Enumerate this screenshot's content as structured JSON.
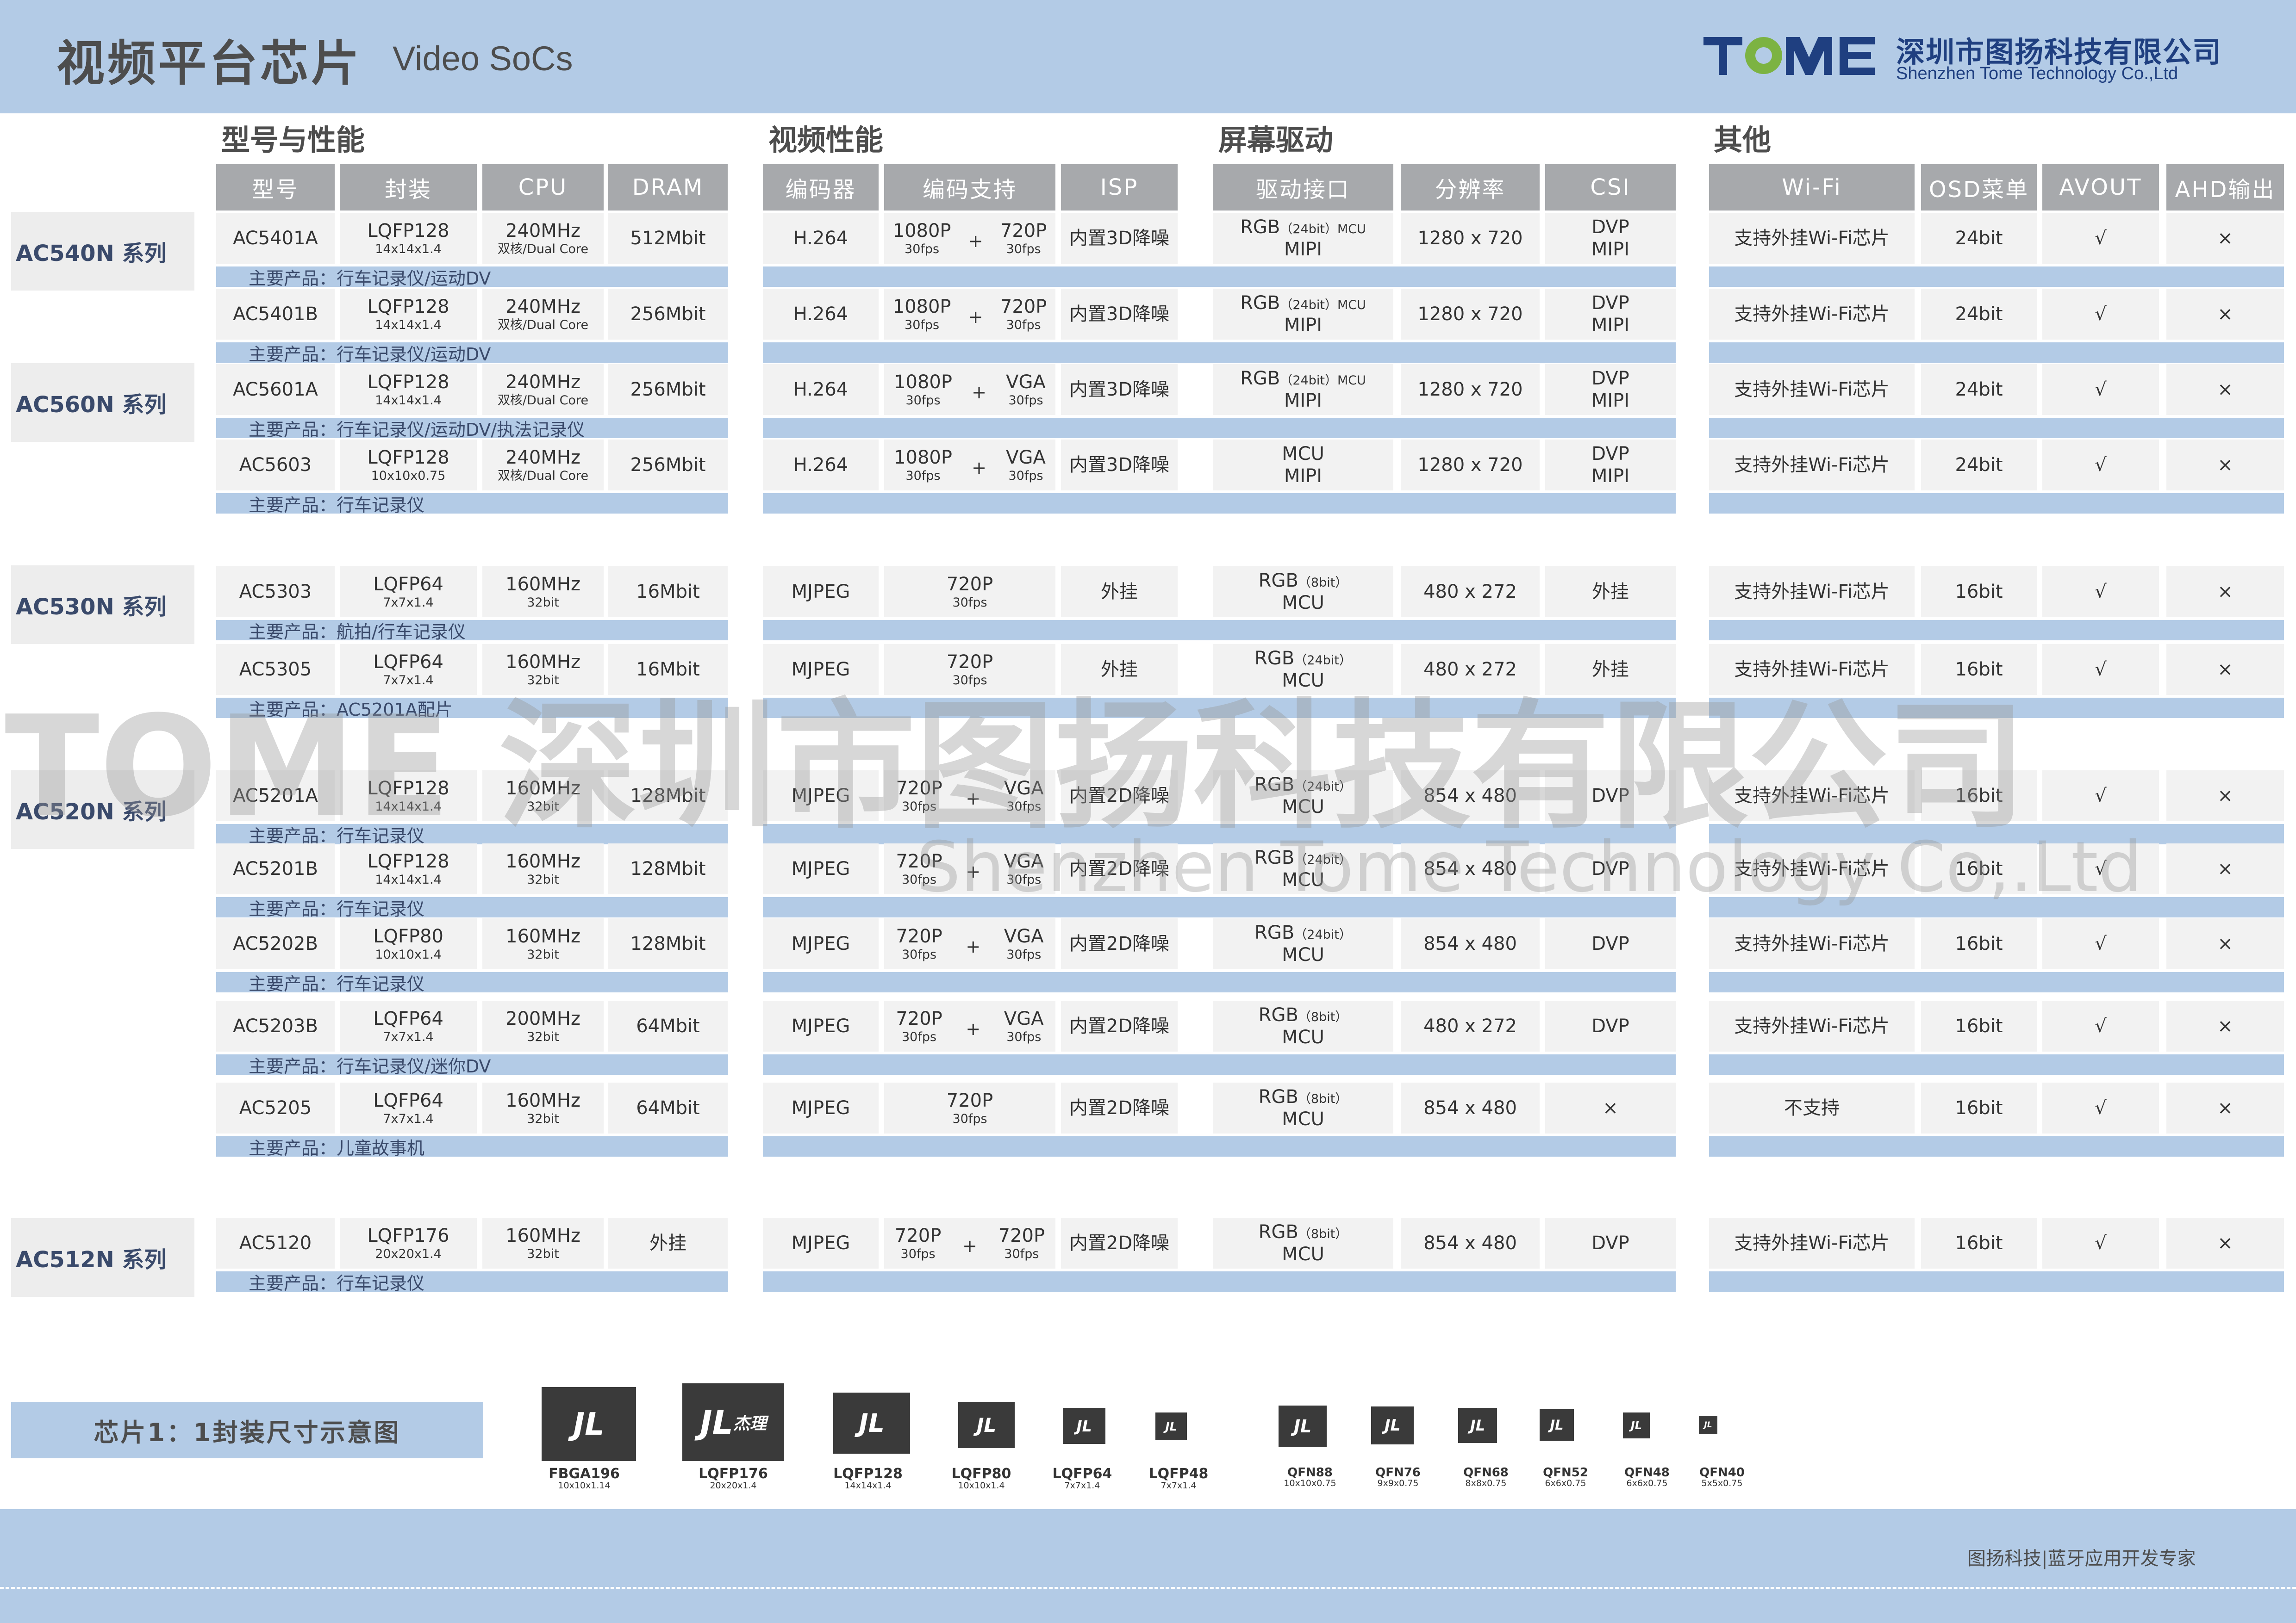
{
  "header": {
    "title_cn": "视频平台芯片",
    "title_en": "Video SoCs",
    "company_cn": "深圳市图扬科技有限公司",
    "company_en": "Shenzhen Tome Technology Co.,Ltd",
    "logo_text": "TOME"
  },
  "sections": {
    "model": "型号与性能",
    "video": "视频性能",
    "screen": "屏幕驱动",
    "other": "其他"
  },
  "columns": [
    "型号",
    "封装",
    "CPU",
    "DRAM",
    "编码器",
    "编码支持",
    "ISP",
    "驱动接口",
    "分辨率",
    "CSI",
    "Wi-Fi",
    "OSD菜单",
    "AVOUT",
    "AHD输出"
  ],
  "series": [
    {
      "label": "AC540N 系列"
    },
    {
      "label": "AC560N 系列"
    },
    {
      "label": "AC530N 系列"
    },
    {
      "label": "AC520N 系列"
    },
    {
      "label": "AC512N 系列"
    }
  ],
  "product_prefix": "主要产品：",
  "rows": [
    {
      "model": "AC5401A",
      "pkg": "LQFP128",
      "pkg_dim": "14x14x1.4",
      "cpu": "240MHz",
      "cpu_sub": "双核/Dual Core",
      "dram": "512Mbit",
      "codec": "H.264",
      "enc": [
        {
          "r": "1080P",
          "f": "30fps"
        },
        {
          "r": "720P",
          "f": "30fps"
        }
      ],
      "isp": "内置3D降噪",
      "drv1": "RGB",
      "drv1s": "（24bit）MCU",
      "drv2": "MIPI",
      "res": "1280 x 720",
      "csi1": "DVP",
      "csi2": "MIPI",
      "wifi": "支持外挂Wi-Fi芯片",
      "osd": "24bit",
      "avout": "√",
      "ahd": "×",
      "product": "行车记录仪/运动DV"
    },
    {
      "model": "AC5401B",
      "pkg": "LQFP128",
      "pkg_dim": "14x14x1.4",
      "cpu": "240MHz",
      "cpu_sub": "双核/Dual Core",
      "dram": "256Mbit",
      "codec": "H.264",
      "enc": [
        {
          "r": "1080P",
          "f": "30fps"
        },
        {
          "r": "720P",
          "f": "30fps"
        }
      ],
      "isp": "内置3D降噪",
      "drv1": "RGB",
      "drv1s": "（24bit）MCU",
      "drv2": "MIPI",
      "res": "1280 x 720",
      "csi1": "DVP",
      "csi2": "MIPI",
      "wifi": "支持外挂Wi-Fi芯片",
      "osd": "24bit",
      "avout": "√",
      "ahd": "×",
      "product": "行车记录仪/运动DV"
    },
    {
      "model": "AC5601A",
      "pkg": "LQFP128",
      "pkg_dim": "14x14x1.4",
      "cpu": "240MHz",
      "cpu_sub": "双核/Dual Core",
      "dram": "256Mbit",
      "codec": "H.264",
      "enc": [
        {
          "r": "1080P",
          "f": "30fps"
        },
        {
          "r": "VGA",
          "f": "30fps"
        }
      ],
      "isp": "内置3D降噪",
      "drv1": "RGB",
      "drv1s": "（24bit）MCU",
      "drv2": "MIPI",
      "res": "1280 x 720",
      "csi1": "DVP",
      "csi2": "MIPI",
      "wifi": "支持外挂Wi-Fi芯片",
      "osd": "24bit",
      "avout": "√",
      "ahd": "×",
      "product": "行车记录仪/运动DV/执法记录仪"
    },
    {
      "model": "AC5603",
      "pkg": "LQFP128",
      "pkg_dim": "10x10x0.75",
      "cpu": "240MHz",
      "cpu_sub": "双核/Dual Core",
      "dram": "256Mbit",
      "codec": "H.264",
      "enc": [
        {
          "r": "1080P",
          "f": "30fps"
        },
        {
          "r": "VGA",
          "f": "30fps"
        }
      ],
      "isp": "内置3D降噪",
      "drv1": "MCU",
      "drv1s": "",
      "drv2": "MIPI",
      "res": "1280 x 720",
      "csi1": "DVP",
      "csi2": "MIPI",
      "wifi": "支持外挂Wi-Fi芯片",
      "osd": "24bit",
      "avout": "√",
      "ahd": "×",
      "product": "行车记录仪"
    },
    {
      "model": "AC5303",
      "pkg": "LQFP64",
      "pkg_dim": "7x7x1.4",
      "cpu": "160MHz",
      "cpu_sub": "32bit",
      "dram": "16Mbit",
      "codec": "MJPEG",
      "enc": [
        {
          "r": "720P",
          "f": "30fps"
        }
      ],
      "isp": "外挂",
      "drv1": "RGB",
      "drv1s": "（8bit）",
      "drv2": "MCU",
      "res": "480 x 272",
      "csi1": "外挂",
      "csi2": "",
      "wifi": "支持外挂Wi-Fi芯片",
      "osd": "16bit",
      "avout": "√",
      "ahd": "×",
      "product": "航拍/行车记录仪"
    },
    {
      "model": "AC5305",
      "pkg": "LQFP64",
      "pkg_dim": "7x7x1.4",
      "cpu": "160MHz",
      "cpu_sub": "32bit",
      "dram": "16Mbit",
      "codec": "MJPEG",
      "enc": [
        {
          "r": "720P",
          "f": "30fps"
        }
      ],
      "isp": "外挂",
      "drv1": "RGB",
      "drv1s": "（24bit）",
      "drv2": "MCU",
      "res": "480 x 272",
      "csi1": "外挂",
      "csi2": "",
      "wifi": "支持外挂Wi-Fi芯片",
      "osd": "16bit",
      "avout": "√",
      "ahd": "×",
      "product": "AC5201A配片"
    },
    {
      "model": "AC5201A",
      "pkg": "LQFP128",
      "pkg_dim": "14x14x1.4",
      "cpu": "160MHz",
      "cpu_sub": "32bit",
      "dram": "128Mbit",
      "codec": "MJPEG",
      "enc": [
        {
          "r": "720P",
          "f": "30fps"
        },
        {
          "r": "VGA",
          "f": "30fps"
        }
      ],
      "isp": "内置2D降噪",
      "drv1": "RGB",
      "drv1s": "（24bit）",
      "drv2": "MCU",
      "res": "854 x 480",
      "csi1": "DVP",
      "csi2": "",
      "wifi": "支持外挂Wi-Fi芯片",
      "osd": "16bit",
      "avout": "√",
      "ahd": "×",
      "product": "行车记录仪"
    },
    {
      "model": "AC5201B",
      "pkg": "LQFP128",
      "pkg_dim": "14x14x1.4",
      "cpu": "160MHz",
      "cpu_sub": "32bit",
      "dram": "128Mbit",
      "codec": "MJPEG",
      "enc": [
        {
          "r": "720P",
          "f": "30fps"
        },
        {
          "r": "VGA",
          "f": "30fps"
        }
      ],
      "isp": "内置2D降噪",
      "drv1": "RGB",
      "drv1s": "（24bit）",
      "drv2": "MCU",
      "res": "854 x 480",
      "csi1": "DVP",
      "csi2": "",
      "wifi": "支持外挂Wi-Fi芯片",
      "osd": "16bit",
      "avout": "√",
      "ahd": "×",
      "product": "行车记录仪"
    },
    {
      "model": "AC5202B",
      "pkg": "LQFP80",
      "pkg_dim": "10x10x1.4",
      "cpu": "160MHz",
      "cpu_sub": "32bit",
      "dram": "128Mbit",
      "codec": "MJPEG",
      "enc": [
        {
          "r": "720P",
          "f": "30fps"
        },
        {
          "r": "VGA",
          "f": "30fps"
        }
      ],
      "isp": "内置2D降噪",
      "drv1": "RGB",
      "drv1s": "（24bit）",
      "drv2": "MCU",
      "res": "854 x 480",
      "csi1": "DVP",
      "csi2": "",
      "wifi": "支持外挂Wi-Fi芯片",
      "osd": "16bit",
      "avout": "√",
      "ahd": "×",
      "product": "行车记录仪"
    },
    {
      "model": "AC5203B",
      "pkg": "LQFP64",
      "pkg_dim": "7x7x1.4",
      "cpu": "200MHz",
      "cpu_sub": "32bit",
      "dram": "64Mbit",
      "codec": "MJPEG",
      "enc": [
        {
          "r": "720P",
          "f": "30fps"
        },
        {
          "r": "VGA",
          "f": "30fps"
        }
      ],
      "isp": "内置2D降噪",
      "drv1": "RGB",
      "drv1s": "（8bit）",
      "drv2": "MCU",
      "res": "480 x 272",
      "csi1": "DVP",
      "csi2": "",
      "wifi": "支持外挂Wi-Fi芯片",
      "osd": "16bit",
      "avout": "√",
      "ahd": "×",
      "product": "行车记录仪/迷你DV"
    },
    {
      "model": "AC5205",
      "pkg": "LQFP64",
      "pkg_dim": "7x7x1.4",
      "cpu": "160MHz",
      "cpu_sub": "32bit",
      "dram": "64Mbit",
      "codec": "MJPEG",
      "enc": [
        {
          "r": "720P",
          "f": "30fps"
        }
      ],
      "isp": "内置2D降噪",
      "drv1": "RGB",
      "drv1s": "（8bit）",
      "drv2": "MCU",
      "res": "854 x 480",
      "csi1": "×",
      "csi2": "",
      "wifi": "不支持",
      "osd": "16bit",
      "avout": "√",
      "ahd": "×",
      "product": "儿童故事机"
    },
    {
      "model": "AC5120",
      "pkg": "LQFP176",
      "pkg_dim": "20x20x1.4",
      "cpu": "160MHz",
      "cpu_sub": "32bit",
      "dram": "外挂",
      "codec": "MJPEG",
      "enc": [
        {
          "r": "720P",
          "f": "30fps"
        },
        {
          "r": "720P",
          "f": "30fps"
        }
      ],
      "isp": "内置2D降噪",
      "drv1": "RGB",
      "drv1s": "（8bit）",
      "drv2": "MCU",
      "res": "854 x 480",
      "csi1": "DVP",
      "csi2": "",
      "wifi": "支持外挂Wi-Fi芯片",
      "osd": "16bit",
      "avout": "√",
      "ahd": "×",
      "product": "行车记录仪"
    }
  ],
  "watermark": {
    "big": "TOME 深圳市图扬科技有限公司",
    "small": "Shenzhen Tome Technology Co,.Ltd"
  },
  "packages": {
    "label": "芯片1：1封装尺寸示意图",
    "chip_mark": "JL",
    "chip_mark_cn": "杰理",
    "items": [
      {
        "name": "FBGA196",
        "dim": "10x10x1.14"
      },
      {
        "name": "LQFP176",
        "dim": "20x20x1.4"
      },
      {
        "name": "LQFP128",
        "dim": "14x14x1.4"
      },
      {
        "name": "LQFP80",
        "dim": "10x10x1.4"
      },
      {
        "name": "LQFP64",
        "dim": "7x7x1.4"
      },
      {
        "name": "LQFP48",
        "dim": "7x7x1.4"
      },
      {
        "name": "QFN88",
        "dim": "10x10x0.75"
      },
      {
        "name": "QFN76",
        "dim": "9x9x0.75"
      },
      {
        "name": "QFN68",
        "dim": "8x8x0.75"
      },
      {
        "name": "QFN52",
        "dim": "6x6x0.75"
      },
      {
        "name": "QFN48",
        "dim": "6x6x0.75"
      },
      {
        "name": "QFN40",
        "dim": "5x5x0.75"
      }
    ]
  },
  "footer": {
    "text": "图扬科技|蓝牙应用开发专家"
  },
  "colors": {
    "header_bg": "#b3cbe6",
    "table_header": "#a7a9ac",
    "cell_bg": "#f2f2f2",
    "strip": "#b3cbe6",
    "brand_blue": "#1f3f80",
    "brand_green": "#7cb342"
  }
}
